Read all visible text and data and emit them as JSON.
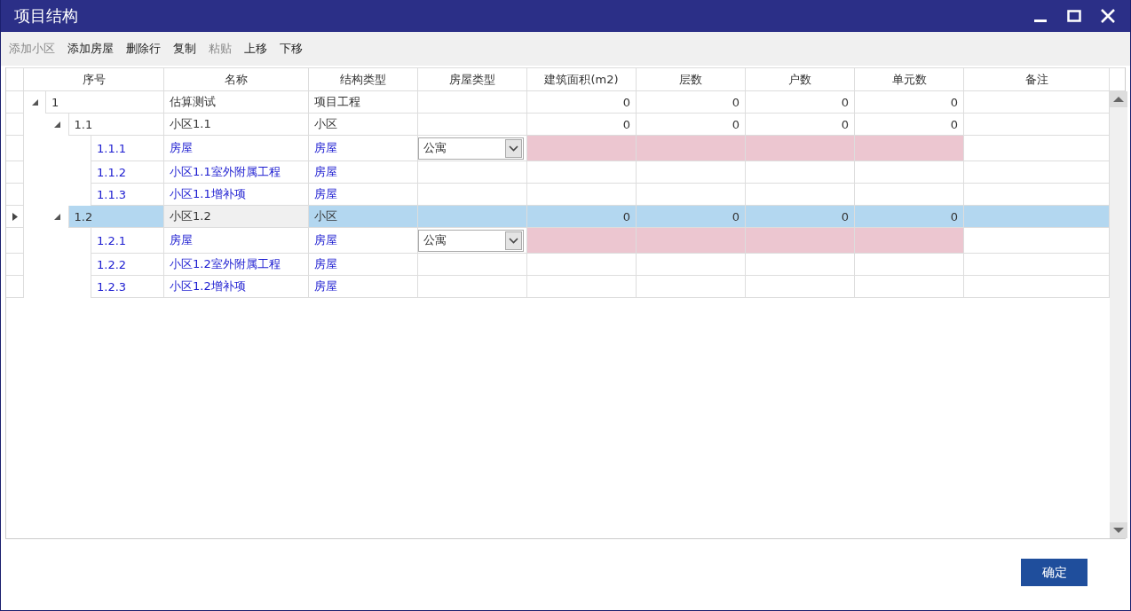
{
  "window": {
    "title": "项目结构"
  },
  "toolbar": [
    {
      "label": "添加小区",
      "disabled": true
    },
    {
      "label": "添加房屋",
      "disabled": false
    },
    {
      "label": "删除行",
      "disabled": false
    },
    {
      "label": "复制",
      "disabled": false
    },
    {
      "label": "粘贴",
      "disabled": true
    },
    {
      "label": "上移",
      "disabled": false
    },
    {
      "label": "下移",
      "disabled": false
    }
  ],
  "table": {
    "columns": [
      "序号",
      "名称",
      "结构类型",
      "房屋类型",
      "建筑面积(m2)",
      "层数",
      "户数",
      "单元数",
      "备注"
    ],
    "rows": [
      {
        "kind": "group",
        "number": "1",
        "name": "估算测试",
        "structure_type": "项目工程",
        "area": "0",
        "floors": "0",
        "households": "0",
        "units": "0",
        "expanded": true,
        "selected": false,
        "children": [
          {
            "kind": "group",
            "number": "1.1",
            "name": "小区1.1",
            "structure_type": "小区",
            "area": "0",
            "floors": "0",
            "households": "0",
            "units": "0",
            "expanded": true,
            "selected": false,
            "children": [
              {
                "kind": "house",
                "number": "1.1.1",
                "name": "房屋",
                "structure_type": "房屋",
                "house_type": "公寓",
                "required": true,
                "selected": false
              },
              {
                "kind": "house",
                "number": "1.1.2",
                "name": "小区1.1室外附属工程",
                "structure_type": "房屋",
                "required": false,
                "selected": false
              },
              {
                "kind": "house",
                "number": "1.1.3",
                "name": "小区1.1增补项",
                "structure_type": "房屋",
                "required": false,
                "selected": false
              }
            ]
          },
          {
            "kind": "group",
            "number": "1.2",
            "name": "小区1.2",
            "structure_type": "小区",
            "area": "0",
            "floors": "0",
            "households": "0",
            "units": "0",
            "expanded": true,
            "selected": true,
            "children": [
              {
                "kind": "house",
                "number": "1.2.1",
                "name": "房屋",
                "structure_type": "房屋",
                "house_type": "公寓",
                "required": true,
                "selected": false
              },
              {
                "kind": "house",
                "number": "1.2.2",
                "name": "小区1.2室外附属工程",
                "structure_type": "房屋",
                "required": false,
                "selected": false
              },
              {
                "kind": "house",
                "number": "1.2.3",
                "name": "小区1.2增补项",
                "structure_type": "房屋",
                "required": false,
                "selected": false
              }
            ]
          }
        ]
      }
    ]
  },
  "buttons": [
    {
      "label": "确定"
    }
  ]
}
